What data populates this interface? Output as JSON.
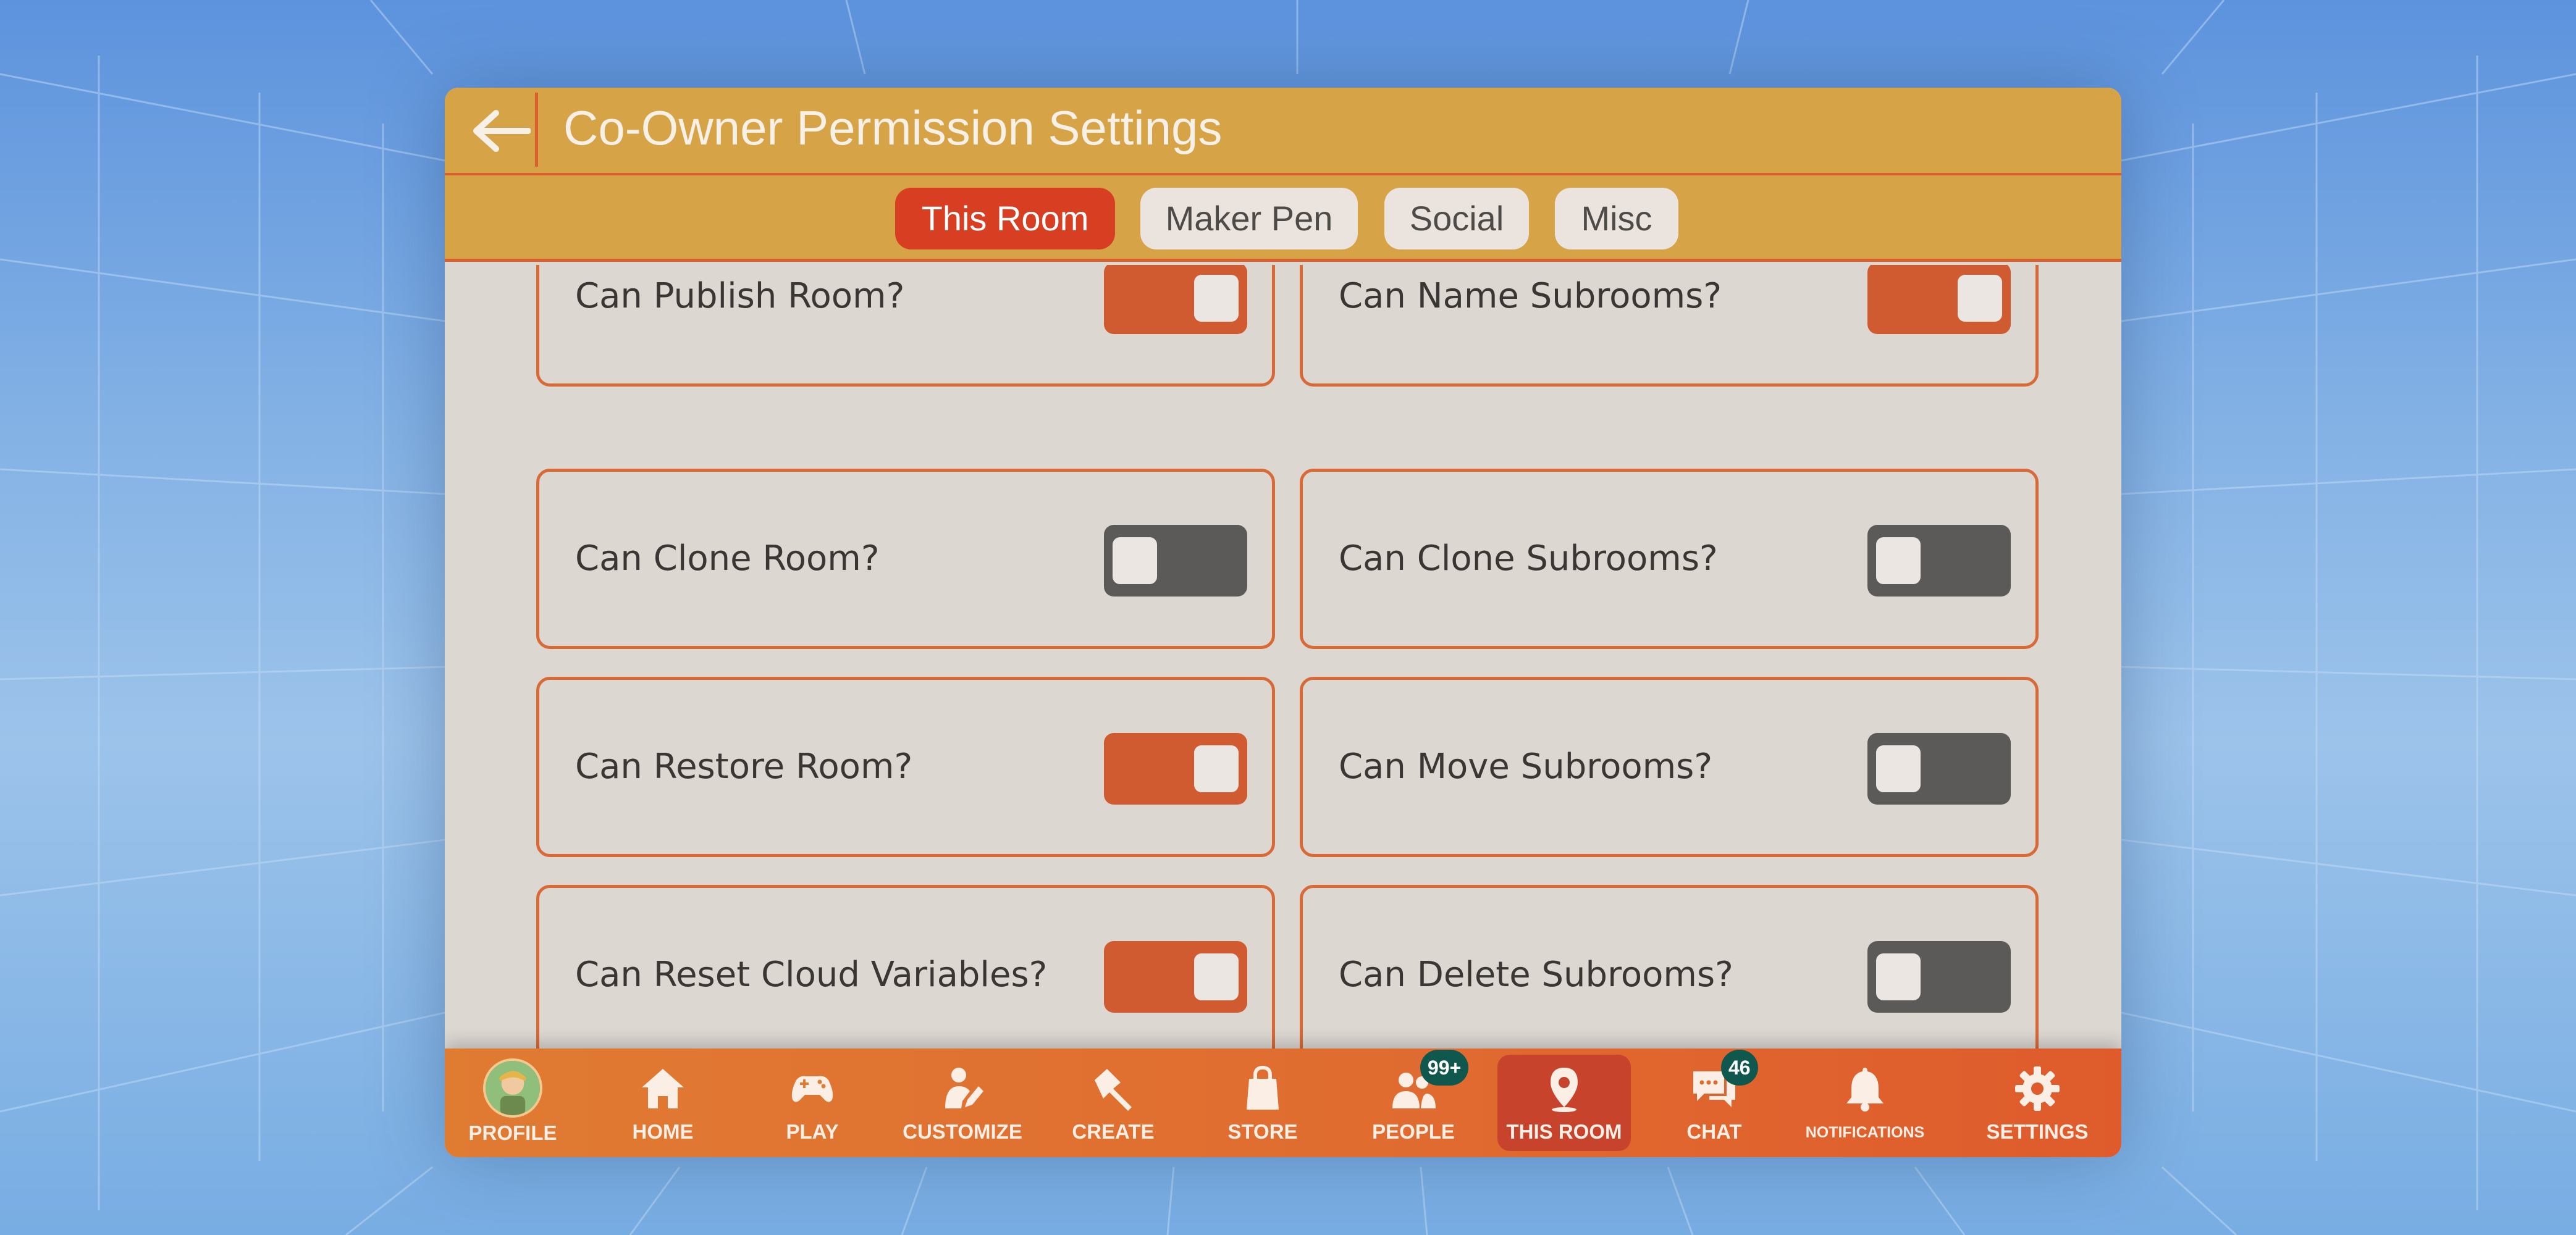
{
  "header": {
    "title": "Co-Owner Permission Settings"
  },
  "tabs": [
    {
      "label": "This Room",
      "active": true
    },
    {
      "label": "Maker Pen",
      "active": false
    },
    {
      "label": "Social",
      "active": false
    },
    {
      "label": "Misc",
      "active": false
    }
  ],
  "permissions": {
    "left": [
      {
        "label": "Can Publish Room?",
        "on": true
      },
      {
        "label": "Can Clone Room?",
        "on": false
      },
      {
        "label": "Can Restore Room?",
        "on": true
      },
      {
        "label": "Can Reset Cloud Variables?",
        "on": true
      }
    ],
    "right": [
      {
        "label": "Can Name Subrooms?",
        "on": true
      },
      {
        "label": "Can Clone Subrooms?",
        "on": false
      },
      {
        "label": "Can Move Subrooms?",
        "on": false
      },
      {
        "label": "Can Delete Subrooms?",
        "on": false
      }
    ]
  },
  "nav": {
    "items": [
      {
        "label": "PROFILE",
        "icon": "avatar"
      },
      {
        "label": "HOME",
        "icon": "home-icon"
      },
      {
        "label": "PLAY",
        "icon": "gamepad-icon"
      },
      {
        "label": "CUSTOMIZE",
        "icon": "customize-icon"
      },
      {
        "label": "CREATE",
        "icon": "maker-pen-icon"
      },
      {
        "label": "STORE",
        "icon": "shopping-bag-icon"
      },
      {
        "label": "PEOPLE",
        "icon": "people-icon",
        "badge": "99+"
      },
      {
        "label": "THIS ROOM",
        "icon": "location-pin-icon",
        "active": true
      },
      {
        "label": "CHAT",
        "icon": "chat-icon",
        "badge": "46"
      },
      {
        "label": "NOTIFICATIONS",
        "icon": "bell-icon"
      },
      {
        "label": "SETTINGS",
        "icon": "gear-icon"
      }
    ]
  },
  "colors": {
    "header": "#d7a347",
    "accent": "#d8602e",
    "active_tab": "#d83e22",
    "toggle_on": "#d15b31",
    "toggle_off": "#5c5a59",
    "badge": "#10584e"
  }
}
